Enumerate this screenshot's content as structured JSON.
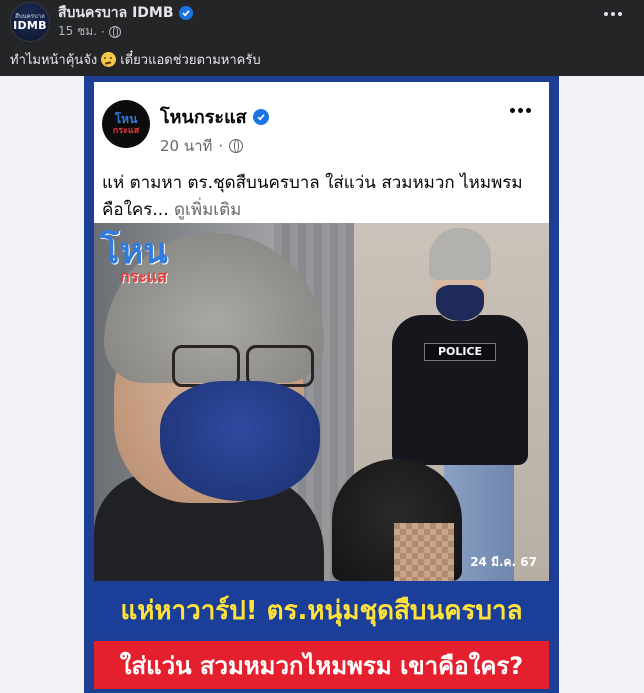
{
  "post": {
    "page_name": "สืบนครบาล IDMB",
    "avatar_text_top": "สืบนครบาล",
    "avatar_text_main": "IDMB",
    "time": "15 ชม.",
    "caption": "ทำไมหน้าคุ้นจัง",
    "caption_after": "เดี๋ยวแอดช่วยตามหาครับ"
  },
  "shared": {
    "page_name": "โหนกระแส",
    "avatar_line1": "โหน",
    "avatar_line2": "กระแส",
    "time": "20 นาที",
    "text": "แห่ ตามหา ตร.ชุดสืบนครบาล ใส่แว่น สวมหมวก ไหมพรม คือใคร...",
    "see_more": "ดูเพิ่มเติม",
    "photo_logo_line1": "โหน",
    "photo_logo_line2": "กระแส",
    "police_patch": "POLICE",
    "photo_date": "24 มี.ค. 67",
    "banner_headline": "แห่หาวาร์ป! ตร.หนุ่มชุดสืบนครบาล",
    "banner_subline": "ใส่แว่น สวมหมวกไหมพรม เขาคือใคร?"
  },
  "colors": {
    "background": "#242526",
    "verified": "#1b74e4",
    "frame_blue": "#1c3f94",
    "banner_yellow": "#ffe23a",
    "banner_red": "#e5202e"
  }
}
